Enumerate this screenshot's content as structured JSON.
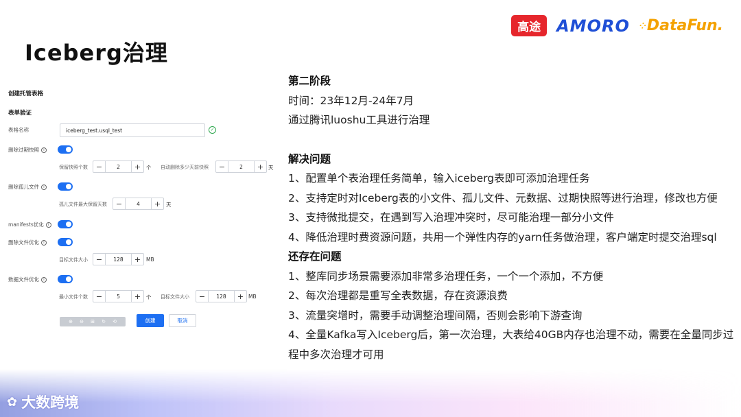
{
  "header": {
    "title": "Iceberg治理",
    "logos": {
      "gaotu": "高途",
      "amoro": "AMORO",
      "datafun": "DataFun."
    }
  },
  "form": {
    "section_create": "创建托管表格",
    "section_validate": "表单验证",
    "table_name_label": "表格名称",
    "table_name_value": "iceberg_test.usql_test",
    "expire_snapshot_label": "删除过期快照",
    "keep_snapshots_label": "保留快照个数",
    "keep_snapshots_value": "2",
    "keep_snapshots_unit": "个",
    "auto_delete_label": "自动删除多少天前快照",
    "auto_delete_value": "2",
    "auto_delete_unit": "天",
    "orphan_label": "删除孤儿文件",
    "orphan_days_label": "孤儿文件最大保留天数",
    "orphan_days_value": "4",
    "orphan_days_unit": "天",
    "manifests_label": "manifests优化",
    "delete_file_label": "删除文件优化",
    "target_size_label": "目标文件大小",
    "target_size_value": "128",
    "target_size_unit": "MB",
    "data_file_label": "数据文件优化",
    "min_files_label": "最小文件个数",
    "min_files_value": "5",
    "min_files_unit": "个",
    "target_size2_label": "目标文件大小",
    "target_size2_value": "128",
    "target_size2_unit": "MB",
    "create_button": "创建",
    "cancel_button": "取消"
  },
  "content": {
    "stage_heading": "第二阶段",
    "time_line": "时间：23年12月-24年7月",
    "tool_line": "通过腾讯luoshu工具进行治理",
    "solve_heading": "解决问题",
    "solve_items": [
      "1、配置单个表治理任务简单，输入iceberg表即可添加治理任务",
      "2、支持定时对Iceberg表的小文件、孤儿文件、元数据、过期快照等进行治理，修改也方便",
      "3、支持微批提交，在遇到写入治理冲突时，尽可能治理一部分小文件",
      "4、降低治理时费资源问题，共用一个弹性内存的yarn任务做治理，客户端定时提交治理sql"
    ],
    "remain_heading": "还存在问题",
    "remain_items": [
      "1、整库同步场景需要添加非常多治理任务，一个一个添加，不方便",
      "2、每次治理都是重写全表数据，存在资源浪费",
      "3、流量突增时，需要手动调整治理间隔，否则会影响下游查询",
      "4、全量Kafka写入Iceberg后，第一次治理，大表给40GB内存也治理不动，需要在全量同步过程中多次治理才可用"
    ]
  },
  "footer": {
    "brand": "大数跨境"
  }
}
